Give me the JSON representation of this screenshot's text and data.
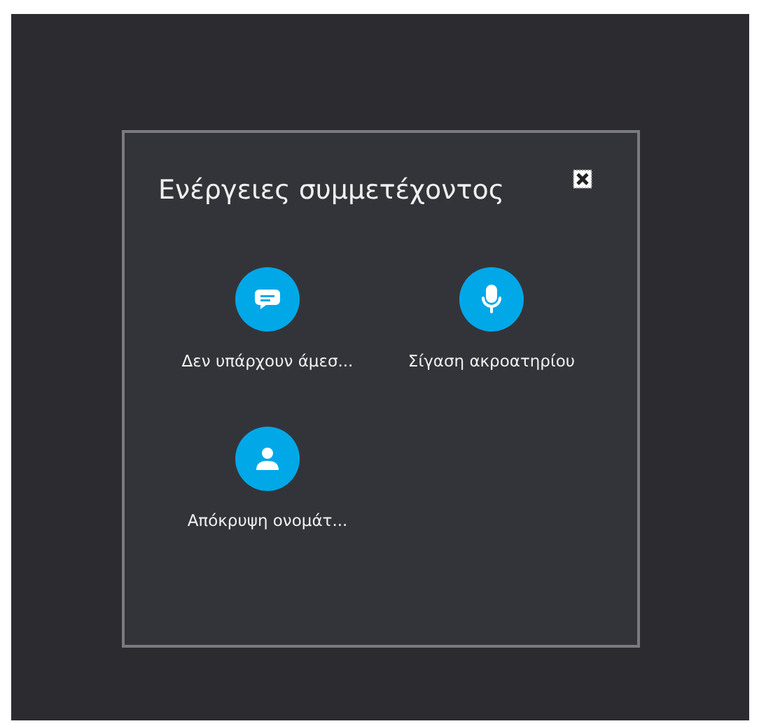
{
  "dialog": {
    "title": "Ενέργειες συμμετέχοντος"
  },
  "actions": [
    {
      "kind": "chat",
      "label": "Δεν υπάρχουν άμεσ..."
    },
    {
      "kind": "mic",
      "label": "Σίγαση ακροατηρίου"
    },
    {
      "kind": "person",
      "label": "Απόκρυψη ονομάτ..."
    }
  ]
}
